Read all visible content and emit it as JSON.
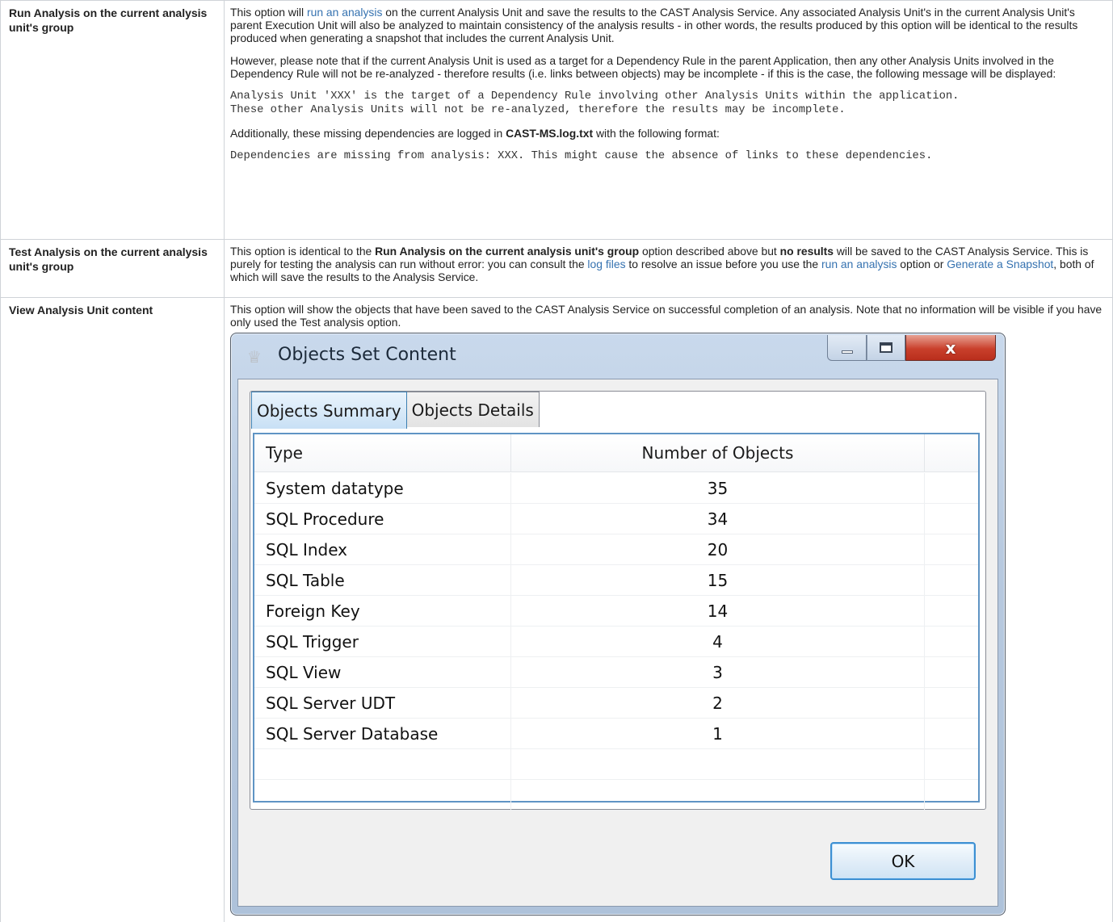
{
  "rows": [
    {
      "key": "Run Analysis on the current analysis unit's group",
      "p1_a": "This option will ",
      "p1_link": "run an analysis",
      "p1_b": " on the current Analysis Unit and save the results to the CAST Analysis Service. Any associated Analysis Unit's in the current Analysis Unit's parent Execution Unit will also be analyzed to maintain consistency of the analysis results - in other words, the results produced by this option will be identical to the results produced when generating a snapshot that includes the current Analysis Unit.",
      "p2": "However, please note that if the current Analysis Unit is used as a target for a Dependency Rule in the parent Application, then any other Analysis Units involved in the Dependency Rule will not be re-analyzed - therefore results (i.e. links between objects) may be incomplete - if this is the case, the following message will be displayed:",
      "code1": "Analysis Unit 'XXX' is the target of a Dependency Rule involving other Analysis Units within the application.\nThese other Analysis Units will not be re-analyzed, therefore the results may be incomplete.",
      "p3_a": "Additionally, these missing dependencies are logged in ",
      "p3_bold": "CAST-MS.log.txt",
      "p3_b": " with the following format:",
      "code2": "Dependencies are missing from analysis: XXX. This might cause the absence of links to these dependencies."
    },
    {
      "key": "Test Analysis on the current analysis unit's group",
      "a": "This option is identical to the ",
      "bold1": "Run Analysis on the current analysis unit's group",
      "b": " option described above but ",
      "bold2": "no results",
      "c": " will be saved to the CAST Analysis Service. This is purely for testing the analysis can run without error: you can consult the ",
      "link1": "log files",
      "d": " to resolve an issue before you use the ",
      "link2": "run an analysis",
      "e": " option or ",
      "link3": "Generate a Snapshot",
      "f": ", both of which will save the results to the Analysis Service."
    },
    {
      "key": "View Analysis Unit content",
      "text": "This option will show the objects that have been saved to the CAST Analysis Service on successful completion of an analysis. Note that no information will be visible if you have only used the Test analysis option."
    }
  ],
  "dialog": {
    "title": "Objects Set Content",
    "tabs": [
      "Objects Summary",
      "Objects Details"
    ],
    "columns": {
      "type": "Type",
      "count": "Number of Objects"
    },
    "items": [
      {
        "type": "System datatype",
        "count": "35"
      },
      {
        "type": "SQL Procedure",
        "count": "34"
      },
      {
        "type": "SQL Index",
        "count": "20"
      },
      {
        "type": "SQL Table",
        "count": "15"
      },
      {
        "type": "Foreign Key",
        "count": "14"
      },
      {
        "type": "SQL Trigger",
        "count": "4"
      },
      {
        "type": "SQL View",
        "count": "3"
      },
      {
        "type": "SQL Server UDT",
        "count": "2"
      },
      {
        "type": "SQL Server Database",
        "count": "1"
      }
    ],
    "ok_label": "OK",
    "close_glyph": "x"
  }
}
